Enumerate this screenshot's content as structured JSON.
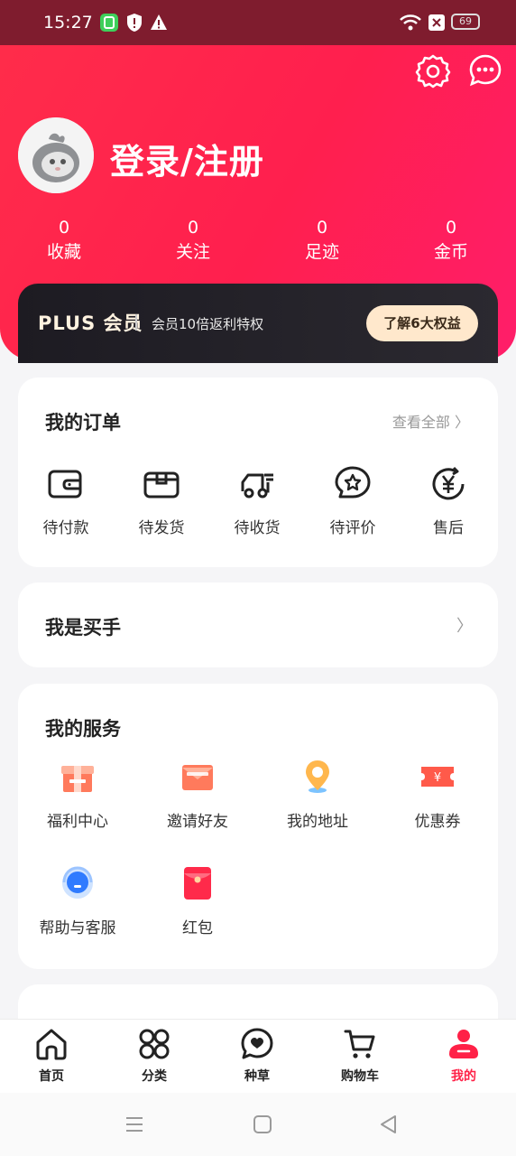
{
  "status_bar": {
    "time": "15:27",
    "battery": "69"
  },
  "header": {
    "login_text": "登录/注册",
    "stats": [
      {
        "value": "0",
        "label": "收藏"
      },
      {
        "value": "0",
        "label": "关注"
      },
      {
        "value": "0",
        "label": "足迹"
      },
      {
        "value": "0",
        "label": "金币"
      }
    ]
  },
  "vip": {
    "brand": "PLUS 会员",
    "text": "会员10倍返利特权",
    "button": "了解6大权益"
  },
  "orders": {
    "title": "我的订单",
    "view_all": "查看全部 〉",
    "items": [
      {
        "label": "待付款",
        "icon": "wallet-icon"
      },
      {
        "label": "待发货",
        "icon": "box-icon"
      },
      {
        "label": "待收货",
        "icon": "delivery-truck-icon"
      },
      {
        "label": "待评价",
        "icon": "star-chat-icon"
      },
      {
        "label": "售后",
        "icon": "yen-refund-icon"
      }
    ]
  },
  "buyer": {
    "title": "我是买手",
    "chevron": "〉"
  },
  "services": {
    "title": "我的服务",
    "items": [
      {
        "label": "福利中心",
        "icon": "gift-icon"
      },
      {
        "label": "邀请好友",
        "icon": "envelope-icon"
      },
      {
        "label": "我的地址",
        "icon": "location-pin-icon"
      },
      {
        "label": "优惠券",
        "icon": "coupon-icon"
      },
      {
        "label": "帮助与客服",
        "icon": "customer-service-icon"
      },
      {
        "label": "红包",
        "icon": "red-packet-icon"
      }
    ]
  },
  "tabbar": {
    "items": [
      {
        "label": "首页",
        "icon": "home-icon"
      },
      {
        "label": "分类",
        "icon": "category-icon"
      },
      {
        "label": "种草",
        "icon": "heart-chat-icon"
      },
      {
        "label": "购物车",
        "icon": "cart-icon"
      },
      {
        "label": "我的",
        "icon": "profile-icon",
        "active": true
      }
    ]
  },
  "colors": {
    "accent": "#ff2147",
    "vip_dark": "#1d1b22",
    "vip_gold": "#ffe8cc"
  }
}
